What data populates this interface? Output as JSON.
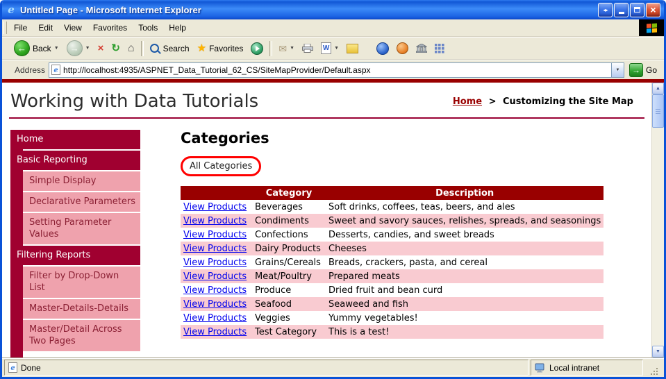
{
  "window": {
    "title": "Untitled Page - Microsoft Internet Explorer"
  },
  "menu": {
    "items": [
      "File",
      "Edit",
      "View",
      "Favorites",
      "Tools",
      "Help"
    ]
  },
  "toolbar": {
    "back_label": "Back",
    "search_label": "Search",
    "favorites_label": "Favorites"
  },
  "address": {
    "label": "Address",
    "url": "http://localhost:4935/ASPNET_Data_Tutorial_62_CS/SiteMapProvider/Default.aspx",
    "go_label": "Go"
  },
  "page": {
    "site_title": "Working with Data Tutorials",
    "breadcrumb": {
      "home": "Home",
      "separator": ">",
      "current": "Customizing the Site Map"
    },
    "sidebar": {
      "items": [
        {
          "label": "Home",
          "level": 1
        },
        {
          "label": "Basic Reporting",
          "level": 1
        },
        {
          "label": "Simple Display",
          "level": 2
        },
        {
          "label": "Declarative Parameters",
          "level": 2
        },
        {
          "label": "Setting Parameter Values",
          "level": 2
        },
        {
          "label": "Filtering Reports",
          "level": 1
        },
        {
          "label": "Filter by Drop-Down List",
          "level": 2
        },
        {
          "label": "Master-Details-Details",
          "level": 2
        },
        {
          "label": "Master/Detail Across Two Pages",
          "level": 2
        }
      ]
    },
    "main": {
      "heading": "Categories",
      "filter_label": "All Categories",
      "table": {
        "link_label": "View Products",
        "headers": [
          "",
          "Category",
          "Description"
        ],
        "rows": [
          {
            "category": "Beverages",
            "description": "Soft drinks, coffees, teas, beers, and ales"
          },
          {
            "category": "Condiments",
            "description": "Sweet and savory sauces, relishes, spreads, and seasonings"
          },
          {
            "category": "Confections",
            "description": "Desserts, candies, and sweet breads"
          },
          {
            "category": "Dairy Products",
            "description": "Cheeses"
          },
          {
            "category": "Grains/Cereals",
            "description": "Breads, crackers, pasta, and cereal"
          },
          {
            "category": "Meat/Poultry",
            "description": "Prepared meats"
          },
          {
            "category": "Produce",
            "description": "Dried fruit and bean curd"
          },
          {
            "category": "Seafood",
            "description": "Seaweed and fish"
          },
          {
            "category": "Veggies",
            "description": "Yummy vegetables!"
          },
          {
            "category": "Test Category",
            "description": "This is a test!"
          }
        ]
      }
    }
  },
  "statusbar": {
    "left": "Done",
    "right": "Local intranet"
  },
  "icons": {
    "app": "e",
    "nav_pair": "◂▸",
    "close": "×",
    "back_arrow": "←",
    "forward_arrow": "→",
    "stop": "×",
    "refresh": "↻",
    "home": "⌂",
    "star": "★",
    "mail": "✉",
    "word": "W",
    "dropdown": "▼",
    "go_arrow": "→",
    "scroll_up": "▲",
    "scroll_down": "▼"
  },
  "colors": {
    "maroon": "#A00030",
    "table_header_red": "#990000",
    "nav_pink": "#EFA2AD",
    "row_pink": "#F9CBD1",
    "link_blue": "#0000EE",
    "annotation_red": "#FF0000"
  }
}
